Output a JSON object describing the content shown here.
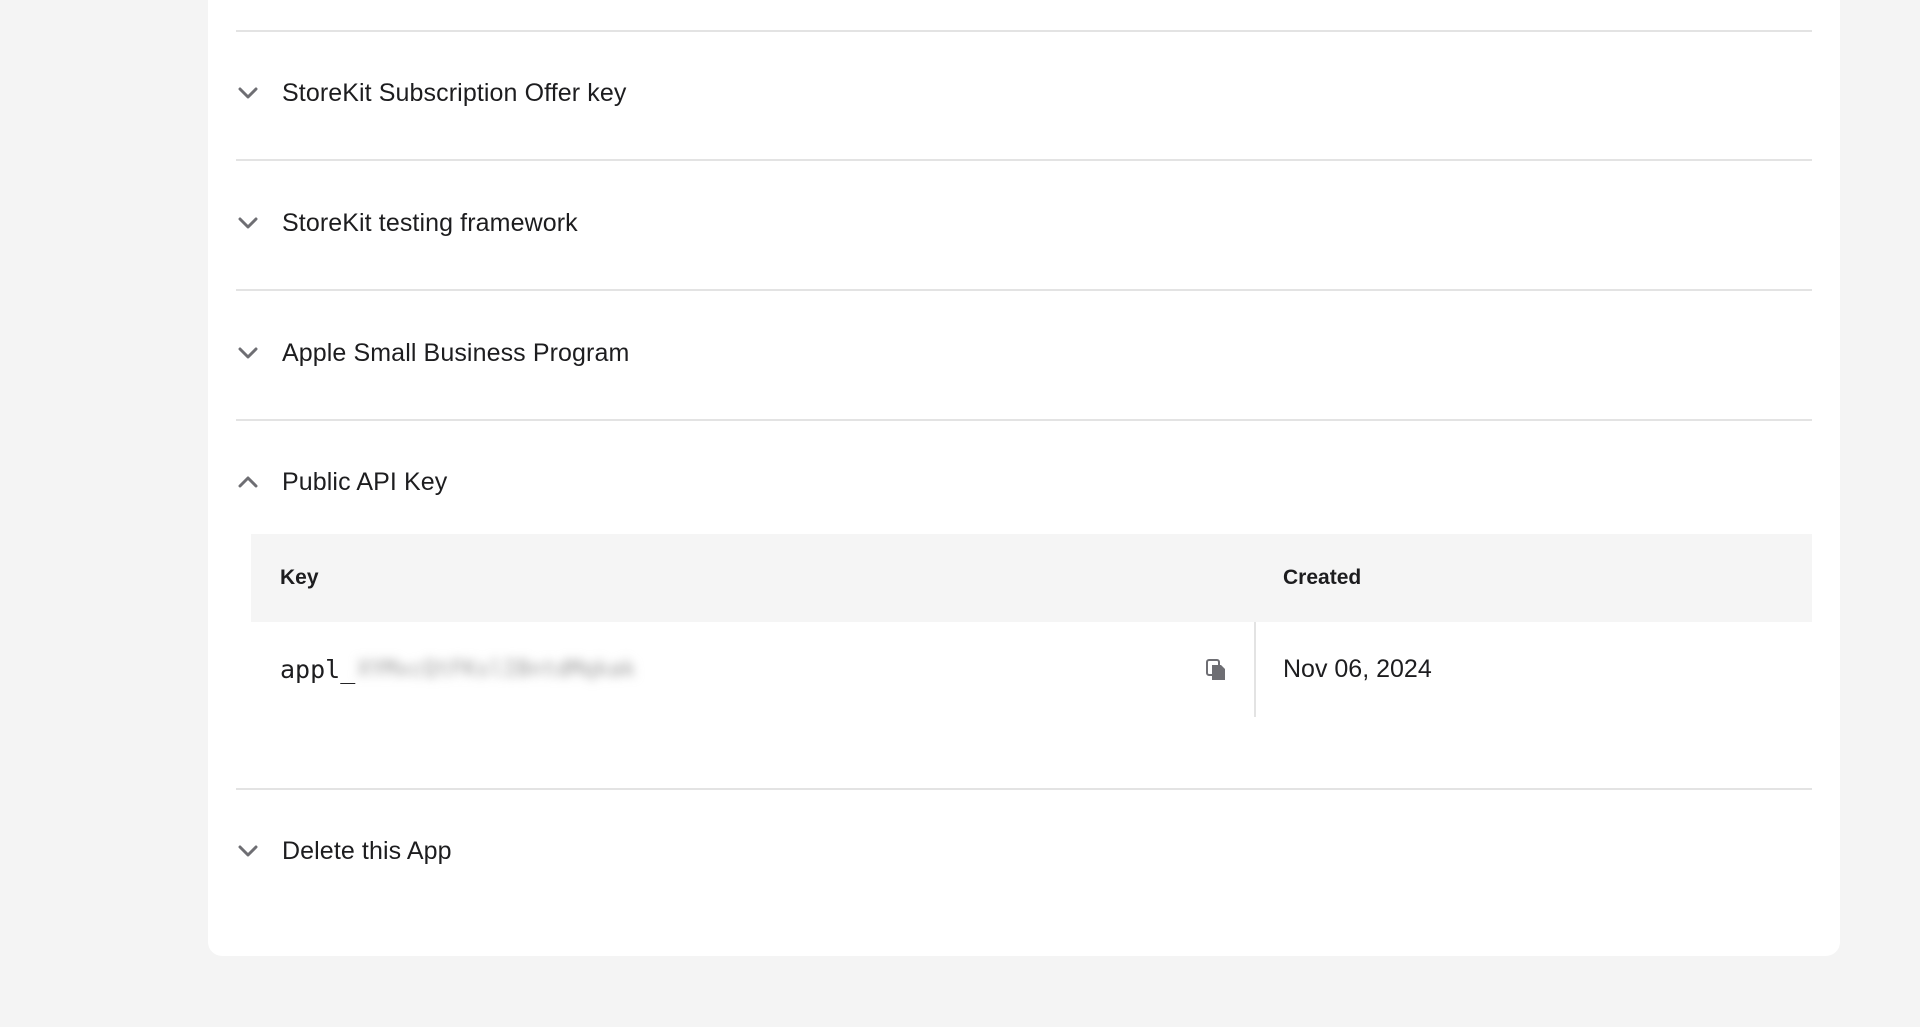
{
  "sections": [
    {
      "title": "StoreKit Subscription Offer key",
      "state": "collapsed",
      "icon": "chevron-down-icon"
    },
    {
      "title": "StoreKit testing framework",
      "state": "collapsed",
      "icon": "chevron-down-icon"
    },
    {
      "title": "Apple Small Business Program",
      "state": "collapsed",
      "icon": "chevron-down-icon"
    },
    {
      "title": "Public API Key",
      "state": "expanded",
      "icon": "chevron-up-icon"
    },
    {
      "title": "Delete this App",
      "state": "collapsed",
      "icon": "chevron-down-icon"
    }
  ],
  "api_keys_table": {
    "columns": [
      "Key",
      "Created"
    ],
    "rows": [
      {
        "key_prefix": "appl_",
        "key_redacted": "XYMxcQtFKslIBntdMqkak",
        "created": "Nov 06, 2024"
      }
    ]
  },
  "colors": {
    "page_bg": "#f4f4f4",
    "card_bg": "#ffffff",
    "divider": "#e3e3e3",
    "table_header_bg": "#f5f5f5",
    "text": "#1d1d1f",
    "icon": "#6e6e73"
  }
}
